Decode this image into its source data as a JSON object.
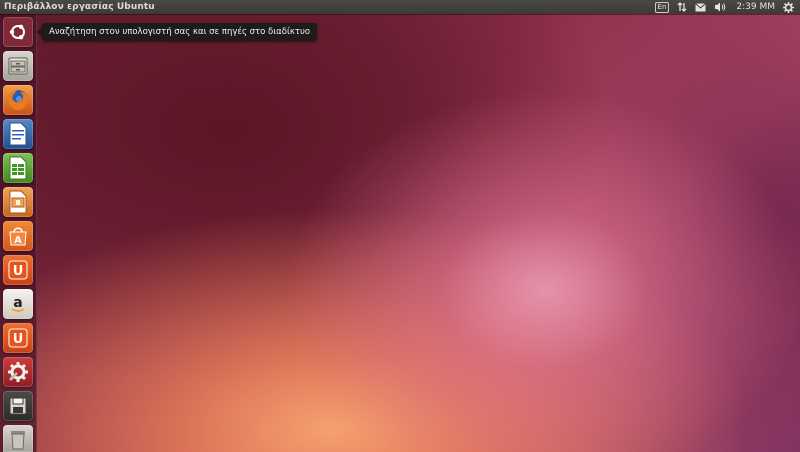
{
  "top_panel": {
    "title": "Περιβάλλον εργασίας Ubuntu",
    "keyboard_layout": "En",
    "clock": "2:39 ΜΜ",
    "icons": [
      "network-updown-icon",
      "mail-icon",
      "volume-icon",
      "gear-icon"
    ]
  },
  "launcher": {
    "tooltip": "Αναζήτηση στον υπολογιστή σας και σε πηγές στο διαδίκτυο",
    "items": [
      {
        "name": "dash-home",
        "icon": "ubuntu-logo-icon"
      },
      {
        "name": "files",
        "icon": "file-cabinet-icon"
      },
      {
        "name": "firefox",
        "icon": "firefox-icon"
      },
      {
        "name": "libreoffice-writer",
        "icon": "writer-icon"
      },
      {
        "name": "libreoffice-calc",
        "icon": "calc-icon"
      },
      {
        "name": "libreoffice-impress",
        "icon": "impress-icon"
      },
      {
        "name": "ubuntu-software-center",
        "icon": "software-center-icon",
        "glyph": "A"
      },
      {
        "name": "ubuntu-one",
        "icon": "ubuntu-one-icon",
        "glyph": "U"
      },
      {
        "name": "amazon",
        "icon": "amazon-icon",
        "glyph": "a"
      },
      {
        "name": "ubuntu-one-music",
        "icon": "ubuntu-one-icon",
        "glyph": "U"
      },
      {
        "name": "system-settings",
        "icon": "settings-icon"
      },
      {
        "name": "workspace",
        "icon": "floppy-icon"
      },
      {
        "name": "trash",
        "icon": "trash-icon"
      }
    ]
  },
  "colors": {
    "panel": "#3c3b37",
    "accent_orange": "#e95420",
    "wallpaper_dark": "#5b1a2c"
  }
}
